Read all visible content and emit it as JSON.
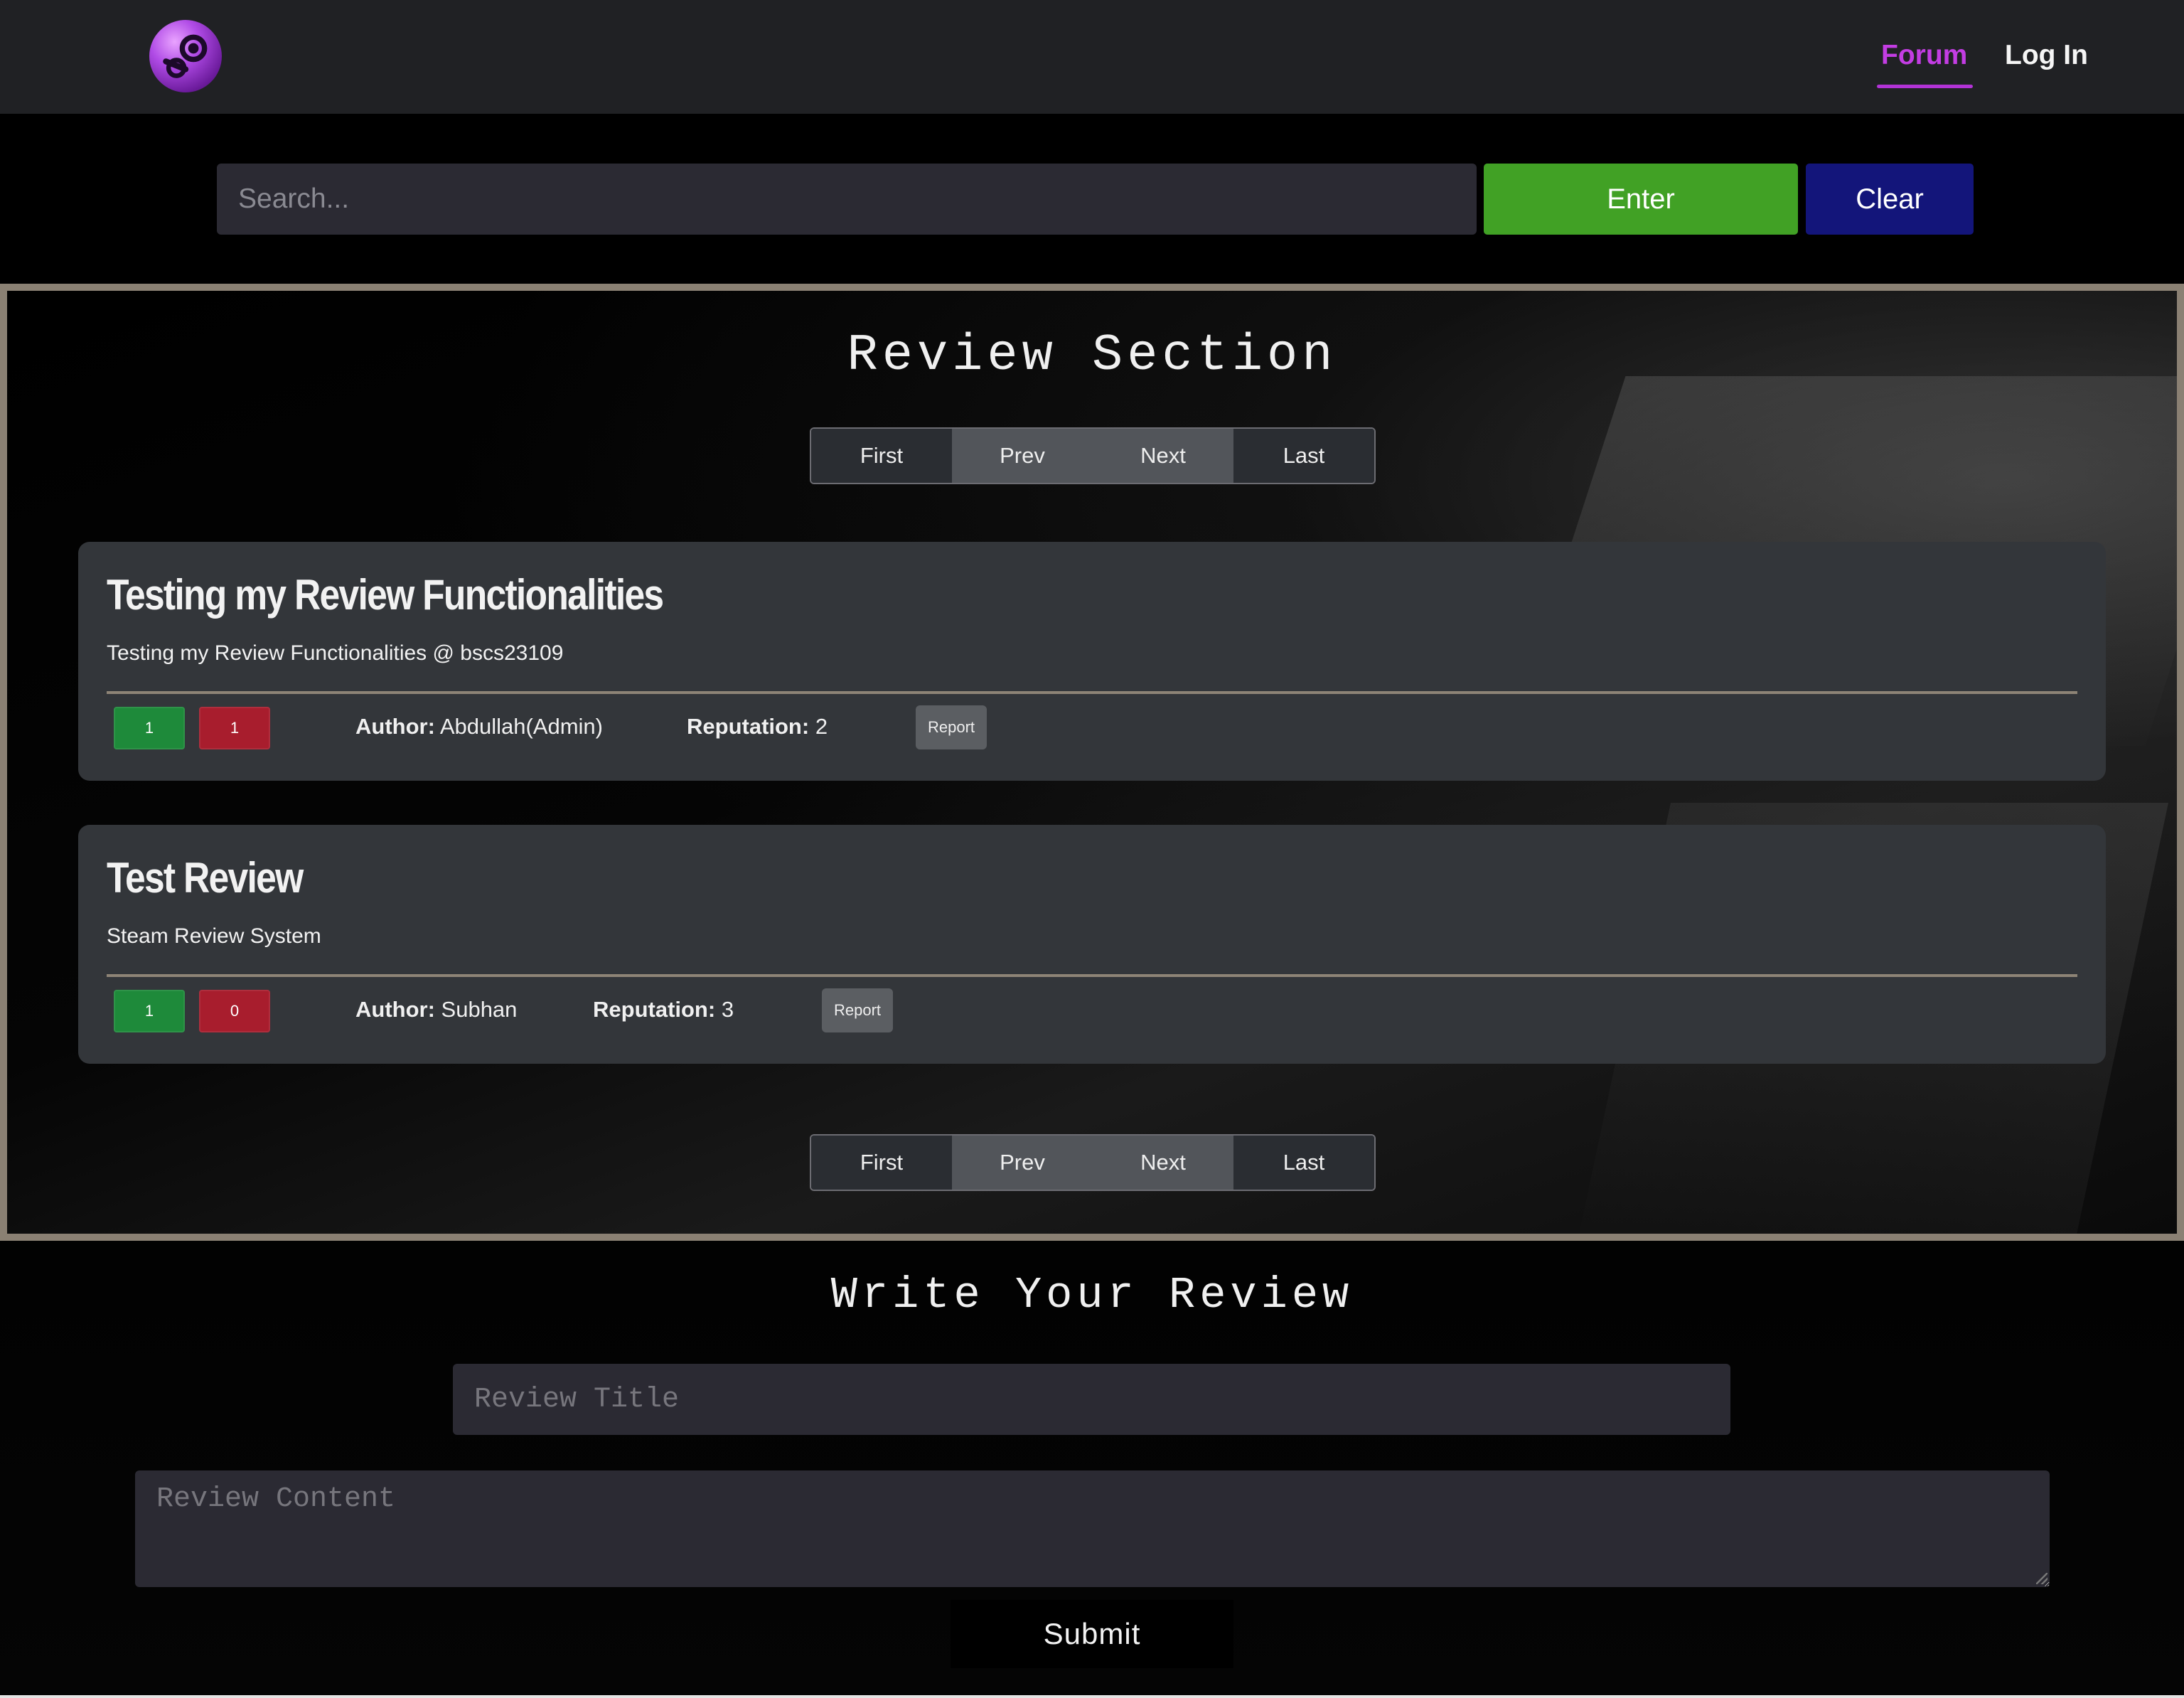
{
  "nav": {
    "logo_icon": "steam-logo-icon",
    "links": [
      {
        "label": "Forum",
        "active": true
      },
      {
        "label": "Log In",
        "active": false
      }
    ],
    "active_color": "#c33de3"
  },
  "search": {
    "placeholder": "Search...",
    "value": "",
    "enter_label": "Enter",
    "clear_label": "Clear"
  },
  "review_section": {
    "title": "Review Section",
    "pagination": {
      "first": "First",
      "prev": "Prev",
      "next": "Next",
      "last": "Last"
    },
    "reviews": [
      {
        "title": "Testing my Review Functionalities",
        "content": "Testing my Review Functionalities @ bscs23109",
        "upvotes": "1",
        "downvotes": "1",
        "author_label": "Author:",
        "author": "Abdullah(Admin)",
        "reputation_label": "Reputation:",
        "reputation": "2",
        "report_label": "Report"
      },
      {
        "title": "Test Review",
        "content": "Steam Review System",
        "upvotes": "1",
        "downvotes": "0",
        "author_label": "Author:",
        "author": "Subhan",
        "reputation_label": "Reputation:",
        "reputation": "3",
        "report_label": "Report"
      }
    ]
  },
  "write_review": {
    "title": "Write Your Review",
    "title_placeholder": "Review Title",
    "content_placeholder": "Review Content",
    "submit_label": "Submit"
  },
  "colors": {
    "enter_button": "#41a125",
    "clear_button": "#13157a",
    "upvote": "#1e8a3a",
    "downvote": "#a81d2d",
    "section_border": "#8a8073"
  }
}
